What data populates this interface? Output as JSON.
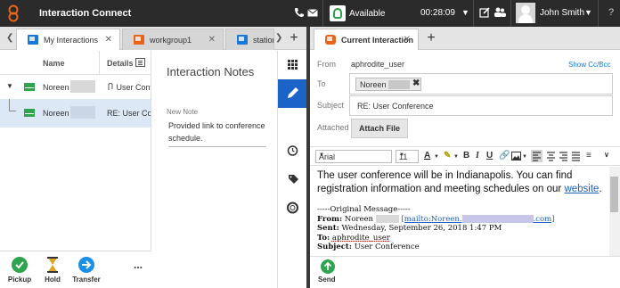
{
  "app": {
    "title": "Interaction Connect"
  },
  "status": {
    "label": "Available",
    "timer": "00:28:09"
  },
  "user": {
    "name": "John Smith"
  },
  "left_tabs": [
    {
      "label": "My Interactions",
      "active": true
    },
    {
      "label": "workgroup1",
      "active": false
    },
    {
      "label": "station",
      "active": false
    }
  ],
  "list": {
    "col_name": "Name",
    "col_details": "Details",
    "rows": [
      {
        "name": "Noreen",
        "detail": "User Confe",
        "expanded": true
      },
      {
        "name": "Noreen",
        "detail": "RE: User Conf",
        "selected": true
      }
    ]
  },
  "notes": {
    "title": "Interaction Notes",
    "label": "New Note",
    "text": "Provided link to conference schedule."
  },
  "actions": [
    {
      "label": "Pickup",
      "icon": "check-icon",
      "color": "#2ea44f"
    },
    {
      "label": "Hold",
      "icon": "hourglass-icon",
      "color": "#b8860b"
    },
    {
      "label": "Transfer",
      "icon": "arrow-right-icon",
      "color": "#1b8ee6"
    }
  ],
  "more_label": "...",
  "right_tab": {
    "label": "Current Interaction"
  },
  "email": {
    "from_label": "From",
    "from_value": "aphrodite_user",
    "show_cc": "Show Cc/Bcc",
    "to_label": "To",
    "to_chip": "Noreen",
    "subject_label": "Subject",
    "subject_value": "RE: User Conference",
    "attached_label": "Attached",
    "attach_button": "Attach File",
    "font": "Arial",
    "size": "11",
    "body_line1": "The user conference will be in Indianapolis. You can find registration information and meeting schedules on our",
    "body_link": "website",
    "body_end": ".",
    "orig_header": "-----Original Message-----",
    "orig_from_label": "From:",
    "orig_from_name": "Noreen",
    "orig_mailto_start": "[mailto:Noreen.",
    "orig_mailto_end": ".com]",
    "orig_sent_label": "Sent:",
    "orig_sent_value": "Wednesday, September 26, 2018 1:47 PM",
    "orig_to_label": "To:",
    "orig_to_value": "aphrodite_user",
    "orig_subject_label": "Subject:",
    "orig_subject_value": "User Conference"
  },
  "send_label": "Send",
  "colors": {
    "topbar": "#2b2b2b",
    "accent_blue": "#1b63c6",
    "green": "#2ea44f",
    "orange": "#e8641b"
  }
}
